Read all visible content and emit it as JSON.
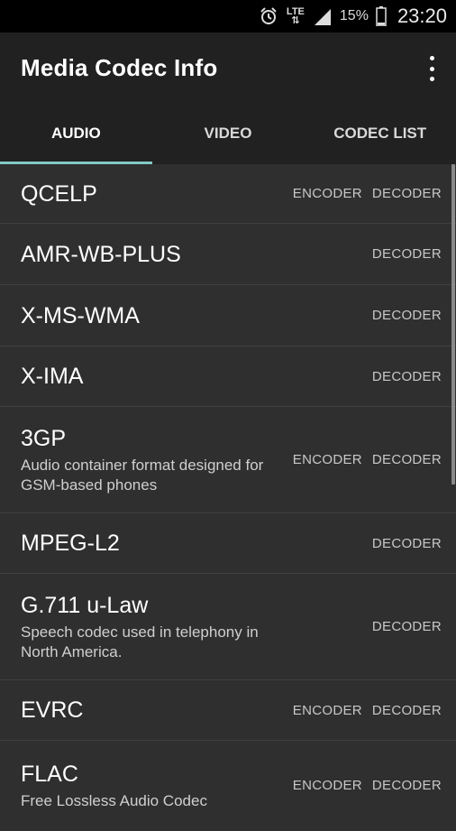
{
  "status_bar": {
    "network": "LTE",
    "battery_percent": "15%",
    "time": "23:20",
    "icons": [
      "alarm-clock-icon",
      "lte-icon",
      "signal-icon",
      "battery-icon"
    ]
  },
  "app_bar": {
    "title": "Media Codec Info",
    "overflow_icon": "more-vert-icon"
  },
  "tabs": [
    {
      "label": "AUDIO",
      "active": true
    },
    {
      "label": "VIDEO",
      "active": false
    },
    {
      "label": "CODEC LIST",
      "active": false
    }
  ],
  "codecs": [
    {
      "name": "QCELP",
      "description": "",
      "encoder": "ENCODER",
      "decoder": "DECODER"
    },
    {
      "name": "AMR-WB-PLUS",
      "description": "",
      "encoder": "",
      "decoder": "DECODER"
    },
    {
      "name": "X-MS-WMA",
      "description": "",
      "encoder": "",
      "decoder": "DECODER"
    },
    {
      "name": "X-IMA",
      "description": "",
      "encoder": "",
      "decoder": "DECODER"
    },
    {
      "name": "3GP",
      "description": "Audio container format designed for GSM-based phones",
      "encoder": "ENCODER",
      "decoder": "DECODER"
    },
    {
      "name": "MPEG-L2",
      "description": "",
      "encoder": "",
      "decoder": "DECODER"
    },
    {
      "name": "G.711 u-Law",
      "description": "Speech codec used in telephony in North America.",
      "encoder": "",
      "decoder": "DECODER"
    },
    {
      "name": "EVRC",
      "description": "",
      "encoder": "ENCODER",
      "decoder": "DECODER"
    },
    {
      "name": "FLAC",
      "description": "Free Lossless Audio Codec",
      "encoder": "ENCODER",
      "decoder": "DECODER"
    }
  ],
  "colors": {
    "tab_indicator": "#80cbc4",
    "background": "#2f2f2f",
    "toolbar": "#212121"
  }
}
